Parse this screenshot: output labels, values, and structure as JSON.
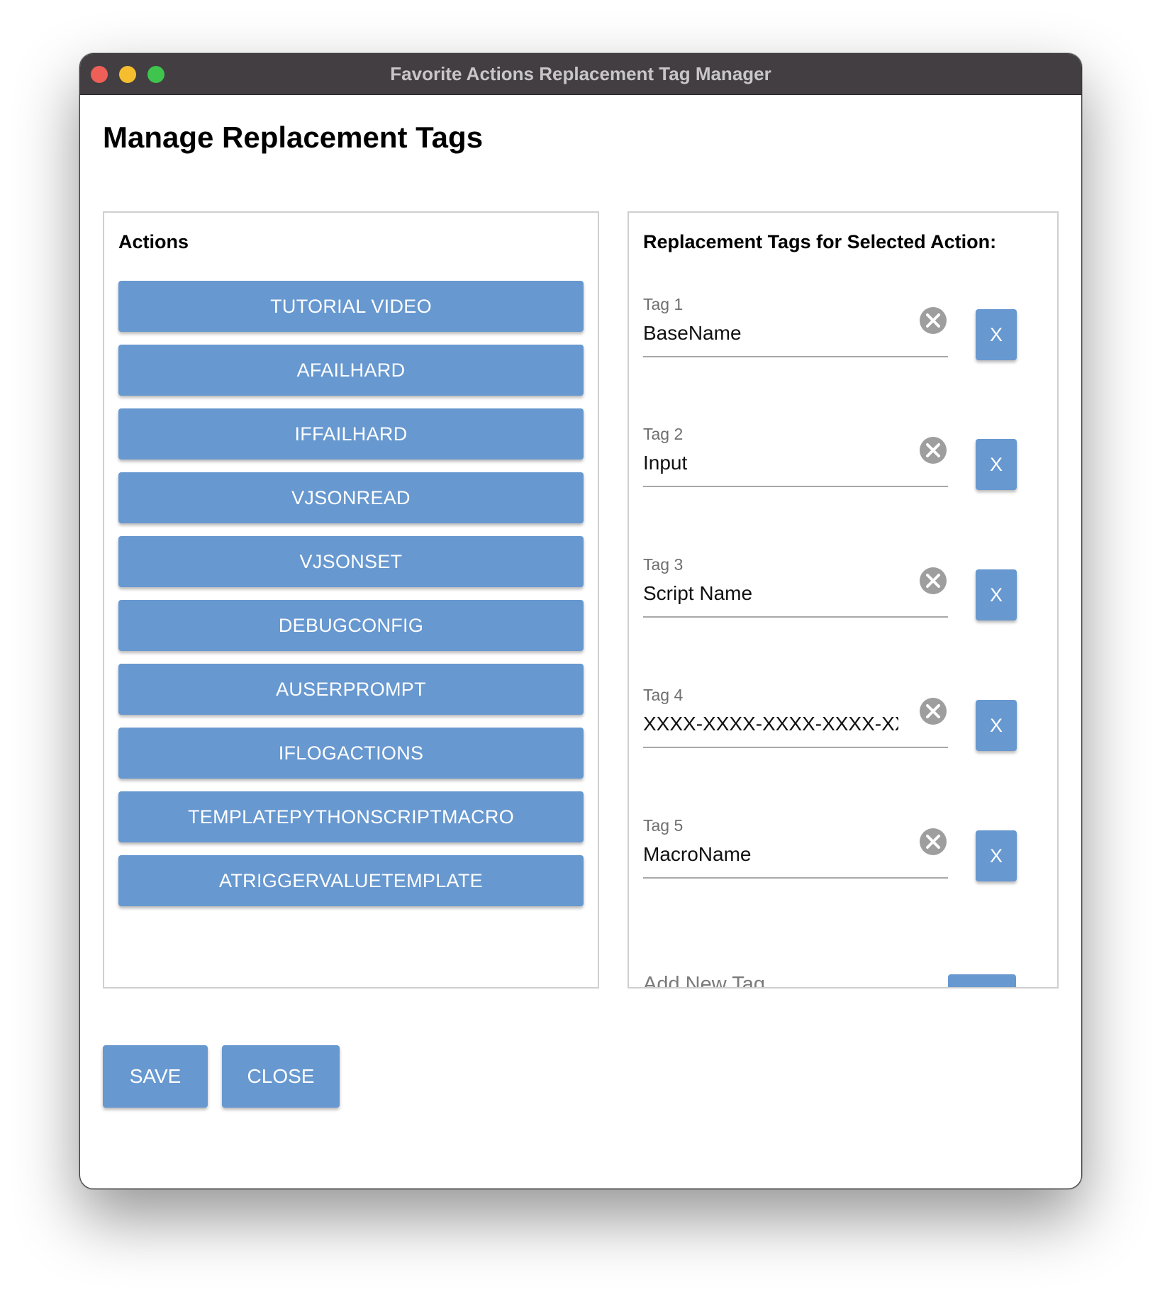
{
  "window": {
    "title": "Favorite Actions Replacement Tag Manager"
  },
  "page": {
    "title": "Manage Replacement Tags"
  },
  "actions_panel": {
    "heading": "Actions",
    "items": [
      {
        "label": "TUTORIAL VIDEO"
      },
      {
        "label": "AFAILHARD"
      },
      {
        "label": "IFFAILHARD"
      },
      {
        "label": "VJSONREAD"
      },
      {
        "label": "VJSONSET"
      },
      {
        "label": "DEBUGCONFIG"
      },
      {
        "label": "AUSERPROMPT"
      },
      {
        "label": "IFLOGACTIONS"
      },
      {
        "label": "TEMPLATEPYTHONSCRIPTMACRO"
      },
      {
        "label": "ATRIGGERVALUETEMPLATE"
      }
    ]
  },
  "tags_panel": {
    "heading": "Replacement Tags for Selected Action:",
    "tags": [
      {
        "label": "Tag 1",
        "value": "BaseName",
        "delete_label": "X"
      },
      {
        "label": "Tag 2",
        "value": "Input",
        "delete_label": "X"
      },
      {
        "label": "Tag 3",
        "value": "Script Name",
        "delete_label": "X"
      },
      {
        "label": "Tag 4",
        "value": "XXXX-XXXX-XXXX-XXXX-XXXX",
        "delete_label": "X"
      },
      {
        "label": "Tag 5",
        "value": "MacroName",
        "delete_label": "X"
      }
    ],
    "add_new_label": "Add New Tag"
  },
  "footer": {
    "save_label": "SAVE",
    "close_label": "CLOSE"
  },
  "icons": {
    "clear": "clear-circle-icon"
  },
  "colors": {
    "button": "#6798d0",
    "titlebar": "#423e41",
    "close_dot": "#ee5f58",
    "minimize_dot": "#f6be2f",
    "zoom_dot": "#3fc44e"
  }
}
